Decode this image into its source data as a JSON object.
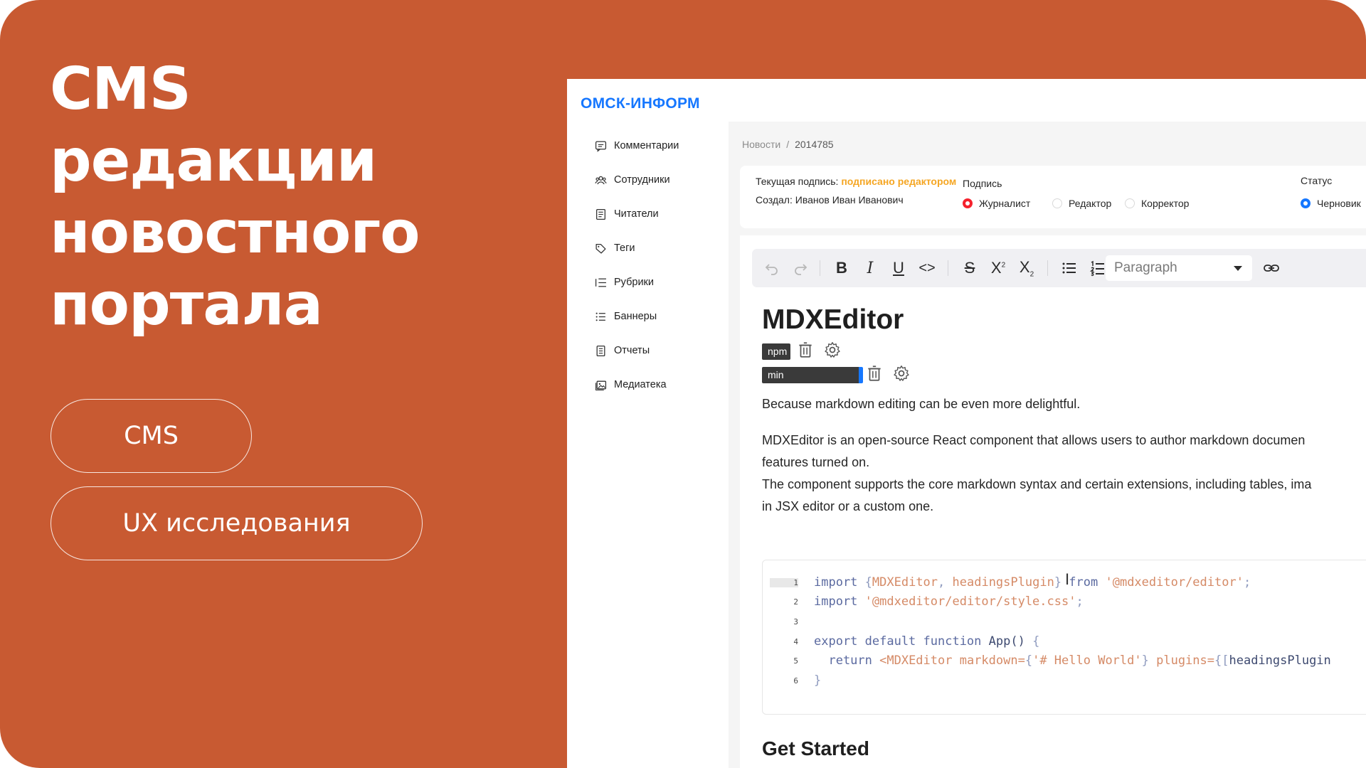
{
  "colors": {
    "accent_background": "#C85A32",
    "brand": "#1677ff",
    "signature_highlight": "#F5A623",
    "radio_selected_red": "#f5222d",
    "radio_selected_blue": "#1677ff"
  },
  "hero": {
    "title_lines": [
      "CMS",
      "редакции",
      "новостного",
      "портала"
    ],
    "tags": [
      "CMS",
      "UX исследования"
    ]
  },
  "app": {
    "brand": "ОМСК-ИНФОРМ",
    "sidebar": {
      "items": [
        {
          "label": "Комментарии",
          "icon": "comment-icon"
        },
        {
          "label": "Сотрудники",
          "icon": "team-icon"
        },
        {
          "label": "Читатели",
          "icon": "book-icon"
        },
        {
          "label": "Теги",
          "icon": "tag-icon"
        },
        {
          "label": "Рубрики",
          "icon": "ordered-list-icon"
        },
        {
          "label": "Баннеры",
          "icon": "list-icon"
        },
        {
          "label": "Отчеты",
          "icon": "report-icon"
        },
        {
          "label": "Медиатека",
          "icon": "media-icon"
        }
      ]
    },
    "breadcrumb": [
      "Новости",
      "2014785"
    ],
    "info": {
      "current_signature_label": "Текущая подпись:",
      "current_signature_value": "подписано редактором",
      "author": "Создал: Иванов Иван Иванович",
      "signature_group": {
        "label": "Подпись",
        "options": [
          "Журналист",
          "Редактор",
          "Корректор"
        ],
        "selected": "Журналист"
      },
      "status_group": {
        "label": "Статус",
        "options": [
          "Черновик"
        ],
        "selected": "Черновик"
      }
    },
    "editor": {
      "toolbar": {
        "icons": [
          "undo-icon",
          "redo-icon",
          "bold-icon",
          "italic-icon",
          "underline-icon",
          "code-icon",
          "strikethrough-icon",
          "superscript-icon",
          "subscript-icon",
          "bullet-list-icon",
          "numbered-list-icon",
          "checklist-icon",
          "link-icon"
        ],
        "block_type": "Paragraph"
      },
      "heading": "MDXEditor",
      "frontmatter_tags": [
        "npm",
        "min"
      ],
      "paragraphs": [
        "Because markdown editing can be even more delightful.",
        "MDXEditor is an open-source React component that allows users to author markdown documen",
        "features turned on.",
        "The component supports the core markdown syntax and certain extensions, including tables, ima",
        "in JSX editor or a custom one."
      ],
      "code_lines": [
        {
          "n": "1",
          "parts": [
            [
              "kw",
              "import "
            ],
            [
              "pn",
              "{"
            ],
            [
              "str",
              "MDXEditor"
            ],
            [
              "pn",
              ", "
            ],
            [
              "str",
              "headingsPlugin"
            ],
            [
              "pn",
              "} "
            ],
            [
              "kw",
              "from "
            ],
            [
              "str",
              "'@mdxeditor/editor'"
            ],
            [
              "pn",
              ";"
            ]
          ]
        },
        {
          "n": "2",
          "parts": [
            [
              "kw",
              "import "
            ],
            [
              "str",
              "'@mdxeditor/editor/style.css'"
            ],
            [
              "pn",
              ";"
            ]
          ]
        },
        {
          "n": "3",
          "parts": []
        },
        {
          "n": "4",
          "parts": [
            [
              "kw",
              "export default function "
            ],
            [
              "idf",
              "App"
            ],
            [
              "idf",
              "() "
            ],
            [
              "pn",
              "{"
            ]
          ]
        },
        {
          "n": "5",
          "parts": [
            [
              "kw",
              "  return "
            ],
            [
              "str",
              "<MDXEditor "
            ],
            [
              "str",
              "markdown="
            ],
            [
              "pn",
              "{"
            ],
            [
              "str",
              "'# Hello World'"
            ],
            [
              "pn",
              "} "
            ],
            [
              "str",
              "plugins="
            ],
            [
              "pn",
              "{["
            ],
            [
              "idf",
              "headingsPlugin"
            ]
          ]
        },
        {
          "n": "6",
          "parts": [
            [
              "pn",
              "}"
            ]
          ]
        }
      ],
      "subheading": "Get Started"
    }
  }
}
